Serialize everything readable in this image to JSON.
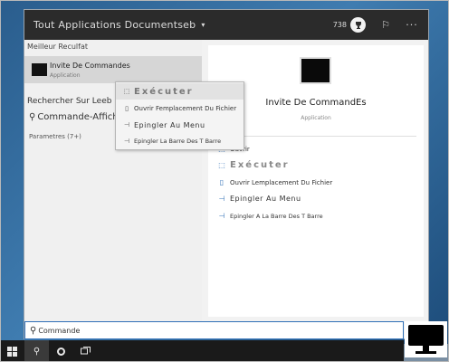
{
  "header": {
    "scope_label": "Tout Applications Documentseb",
    "points": "738"
  },
  "icons": {
    "scope_caret": "▾",
    "trophy": "🏆",
    "feedback": "⚐",
    "more": "···",
    "magnifier": "⚲",
    "pin": "⊣",
    "folder": "▯",
    "run_as": "⬚"
  },
  "left": {
    "best_match_title": "Meilleur Reculfat",
    "best_match_item": {
      "name": "Invite De Commandes",
      "type": "Application"
    },
    "web_search_title": "Rechercher Sur Leeb",
    "web_result": "Commande-Afficher",
    "settings_label": "Parametres (7+)"
  },
  "context_menu": {
    "items": [
      {
        "label": "Exécuter"
      },
      {
        "label": "Ouvrir Femplacement Du Fichier"
      },
      {
        "label": "Epingler Au Menu"
      },
      {
        "label": "Epingler La Barre Des T Barre"
      }
    ]
  },
  "preview": {
    "name": "Invite De CommandEs",
    "type": "Application",
    "actions": [
      {
        "label": "Ouvrir"
      },
      {
        "label": "Exécuter"
      },
      {
        "label": "Ouvrir Lemplacement Du Fichier"
      },
      {
        "label": "Epingler Au Menu"
      },
      {
        "label": "Epingler A La Barre Des T Barre"
      }
    ]
  },
  "search": {
    "value": "Commande"
  },
  "colors": {
    "accent": "#2f6fb6",
    "topbar": "#2b2b2b",
    "taskbar": "#1a1a1a"
  }
}
